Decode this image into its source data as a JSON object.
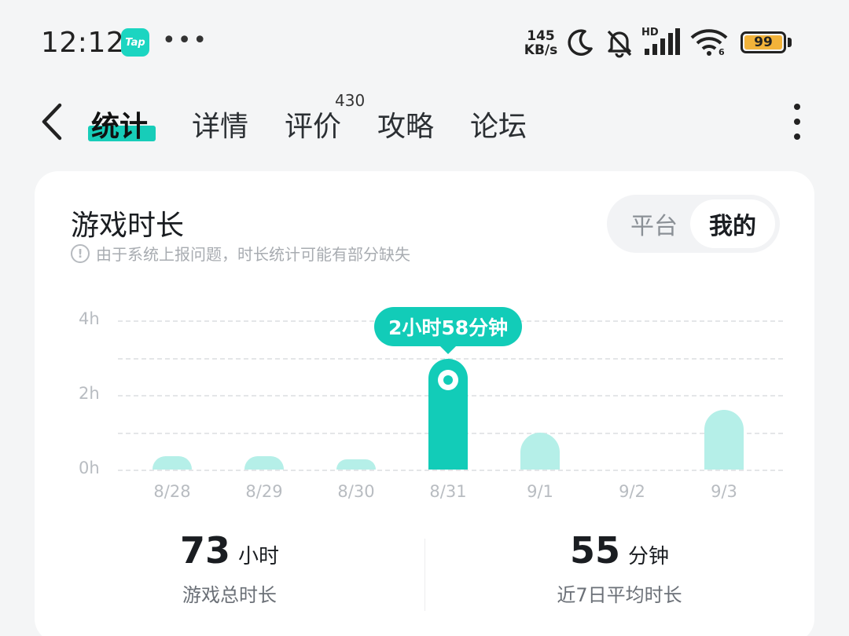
{
  "status_bar": {
    "time": "12:12",
    "app_icon_label": "Tap",
    "more": "•••",
    "net_speed_value": "145",
    "net_speed_unit": "KB/s",
    "hd_label": "HD",
    "wifi_label": "6",
    "battery_level": "99",
    "battery_color": "#f2b33a"
  },
  "nav": {
    "tabs": [
      {
        "label": "统计",
        "active": true
      },
      {
        "label": "详情",
        "active": false
      },
      {
        "label": "评价",
        "active": false
      },
      {
        "label": "攻略",
        "active": false
      },
      {
        "label": "论坛",
        "active": false
      }
    ],
    "review_count": "430",
    "accent_color": "#17cdb9"
  },
  "card": {
    "title": "游戏时长",
    "notice": "由于系统上报问题，时长统计可能有部分缺失",
    "toggle": {
      "platform": "平台",
      "mine": "我的",
      "selected": "mine"
    }
  },
  "chart_data": {
    "type": "bar",
    "categories": [
      "8/28",
      "8/29",
      "8/30",
      "8/31",
      "9/1",
      "9/2",
      "9/3"
    ],
    "values": [
      0.35,
      0.35,
      0.28,
      2.97,
      0.98,
      0,
      1.6
    ],
    "unit": "hours",
    "y_ticks": [
      "4h",
      "2h",
      "0h"
    ],
    "ylim": [
      0,
      4
    ],
    "highlight_index": 3,
    "tooltip": "2小时58分钟",
    "grid": true,
    "colors": {
      "bar": "#b5efe8",
      "highlight": "#12ccb8"
    }
  },
  "stats": {
    "total": {
      "value": "73",
      "unit": "小时",
      "label": "游戏总时长"
    },
    "average": {
      "value": "55",
      "unit": "分钟",
      "label": "近7日平均时长"
    }
  }
}
